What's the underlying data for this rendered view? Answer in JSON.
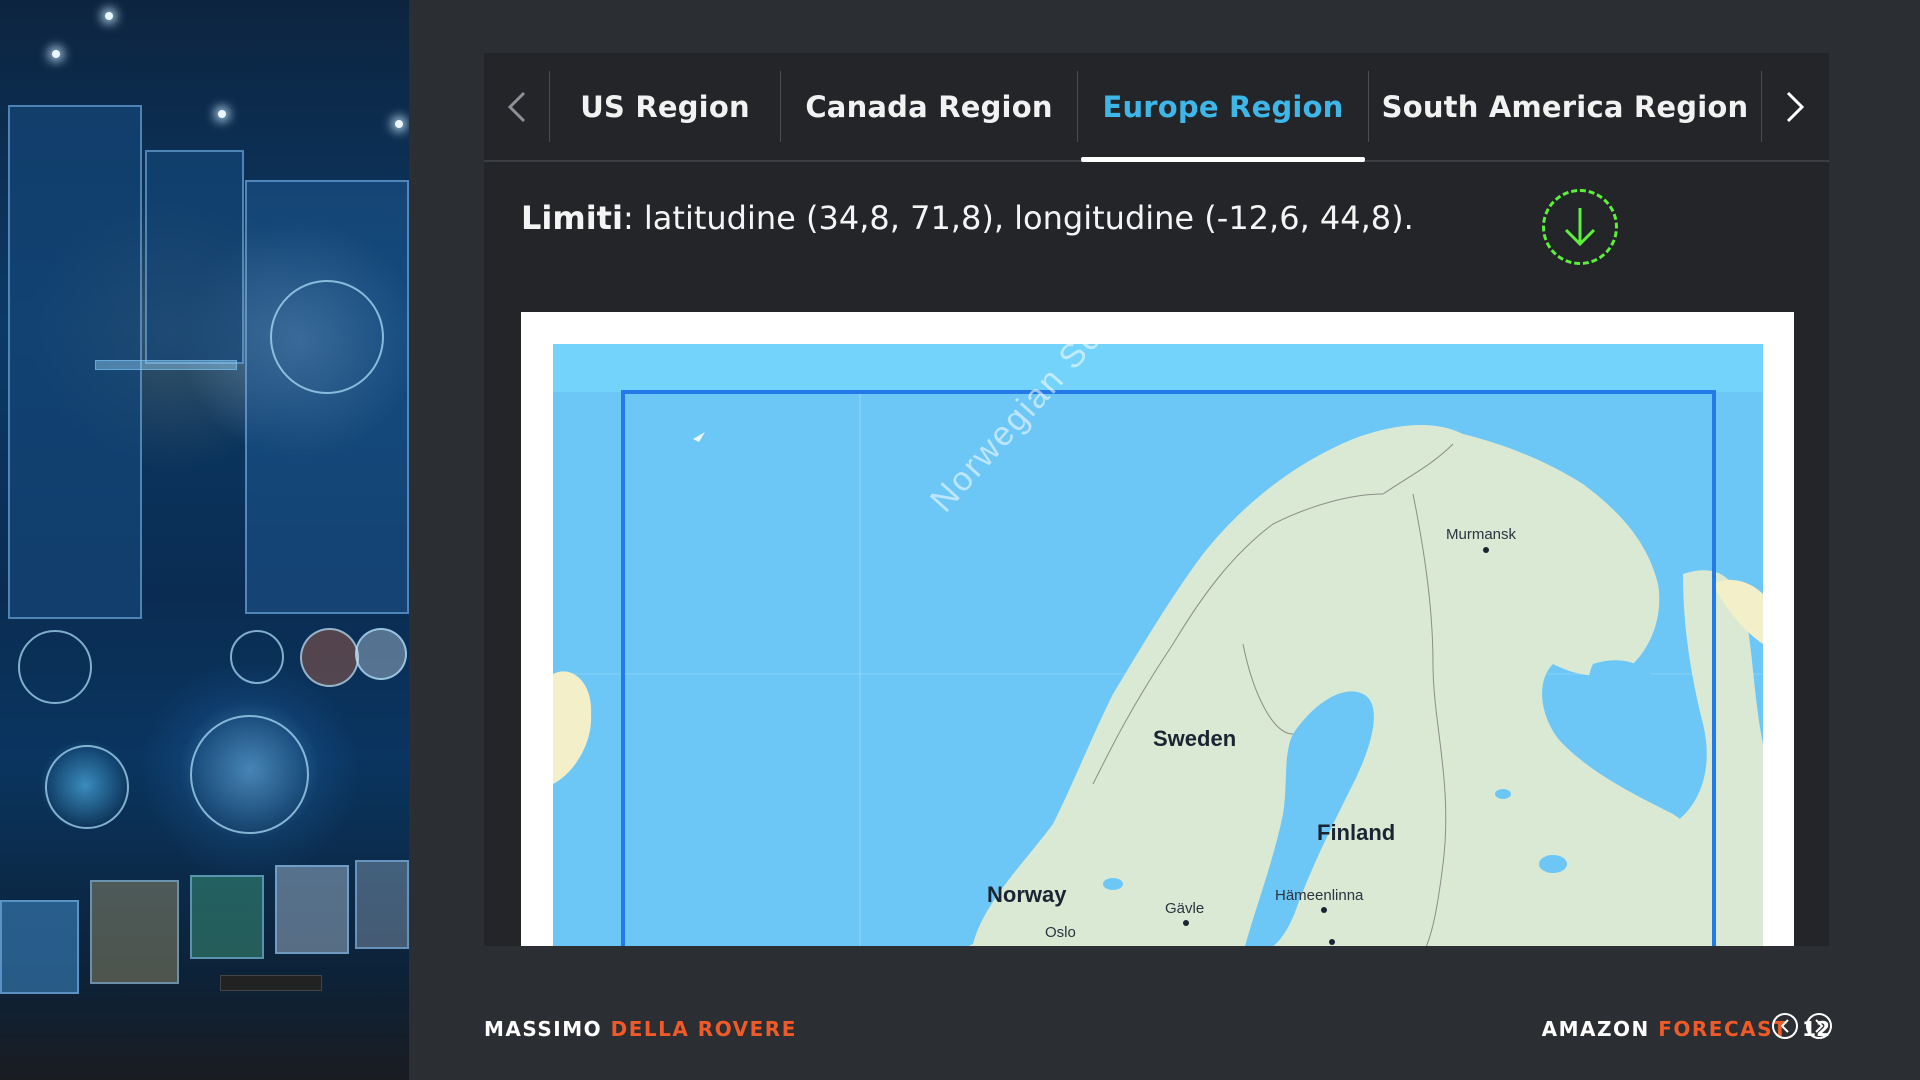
{
  "tabs": {
    "items": [
      {
        "label": "US Region",
        "active": false
      },
      {
        "label": "Canada Region",
        "active": false
      },
      {
        "label": "Europe Region",
        "active": true
      },
      {
        "label": "South America Region",
        "active": false
      }
    ],
    "prev_icon": "chevron-left-icon",
    "next_icon": "chevron-right-icon"
  },
  "content": {
    "limits_label": "Limiti",
    "limits_text": ": latitudine (34,8, 71,8), longitudine (-12,6, 44,8).",
    "download_icon": "download-icon",
    "download_color": "#5df03a"
  },
  "map": {
    "sea_label": "Norwegian Sea",
    "countries": [
      "Sweden",
      "Finland",
      "Norway"
    ],
    "cities": [
      "Murmansk",
      "Gävle",
      "Hämeenlinna",
      "Oslo"
    ]
  },
  "footer": {
    "author_first": "MASSIMO",
    "author_last": "DELLA ROVERE",
    "course_first": "AMAZON",
    "course_last": "FORECAST",
    "page_number": "12"
  },
  "colors": {
    "accent": "#f05a28",
    "active_tab": "#3fb6e8",
    "background": "#2b2e32"
  }
}
